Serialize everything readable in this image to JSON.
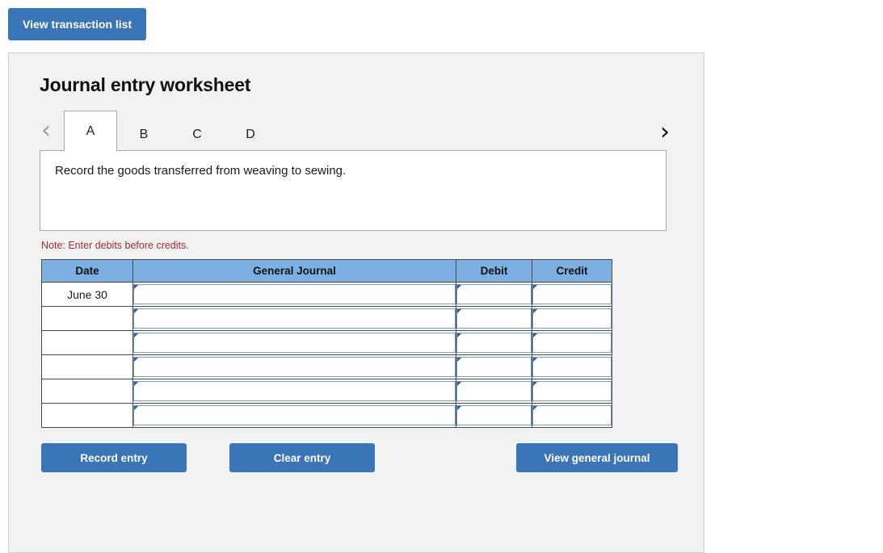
{
  "top": {
    "view_transaction_list_label": "View transaction list"
  },
  "worksheet": {
    "title": "Journal entry worksheet",
    "nav": {
      "prev_icon": "chevron-left-icon",
      "next_icon": "chevron-right-icon"
    },
    "tabs": [
      {
        "label": "A",
        "active": true
      },
      {
        "label": "B",
        "active": false
      },
      {
        "label": "C",
        "active": false
      },
      {
        "label": "D",
        "active": false
      }
    ],
    "description": "Record the goods transferred from weaving to sewing.",
    "note": "Note: Enter debits before credits."
  },
  "journal_table": {
    "columns": [
      "Date",
      "General Journal",
      "Debit",
      "Credit"
    ],
    "rows": [
      {
        "date": "June 30",
        "general_journal": "",
        "debit": "",
        "credit": ""
      },
      {
        "date": "",
        "general_journal": "",
        "debit": "",
        "credit": ""
      },
      {
        "date": "",
        "general_journal": "",
        "debit": "",
        "credit": ""
      },
      {
        "date": "",
        "general_journal": "",
        "debit": "",
        "credit": ""
      },
      {
        "date": "",
        "general_journal": "",
        "debit": "",
        "credit": ""
      },
      {
        "date": "",
        "general_journal": "",
        "debit": "",
        "credit": ""
      }
    ]
  },
  "actions": {
    "record_entry_label": "Record entry",
    "clear_entry_label": "Clear entry",
    "view_general_journal_label": "View general journal"
  },
  "colors": {
    "button_blue": "#3a75b8",
    "table_header_blue": "#7cafe2",
    "note_red": "#a12c37",
    "panel_bg": "#f2f2f2",
    "cell_border_blue": "#6f9fd0",
    "cell_marker_blue": "#2c5f9e"
  }
}
